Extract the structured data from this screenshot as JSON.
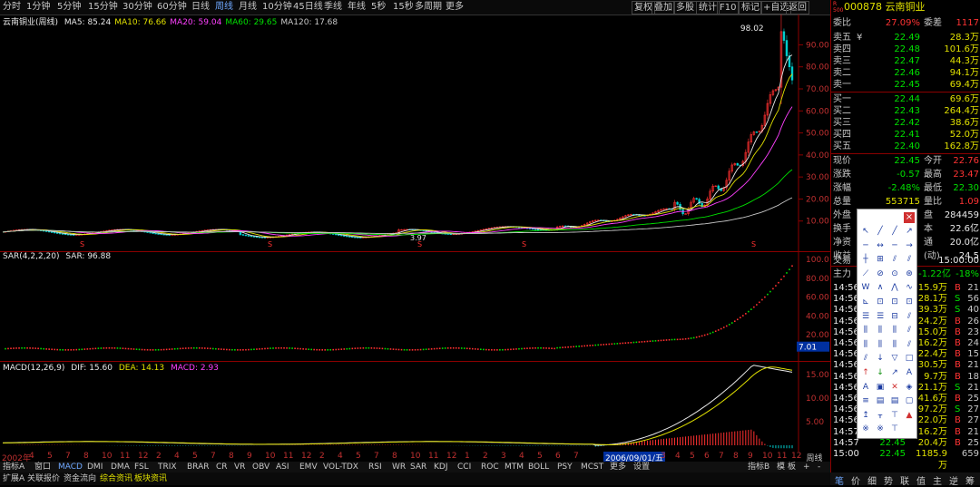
{
  "toolbar": {
    "periods": [
      "分时",
      "1分钟",
      "5分钟",
      "15分钟",
      "30分钟",
      "60分钟",
      "日线",
      "周线",
      "月线",
      "10分钟",
      "45日线",
      "季线",
      "年线",
      "5秒",
      "15秒",
      "多周期",
      "更多"
    ],
    "active_period": "周线",
    "right_buttons": [
      "复权",
      "叠加",
      "多股",
      "统计",
      "F10",
      "标记",
      "+自选",
      "返回"
    ]
  },
  "main_chart": {
    "stock_label": "云南铜业(周线)",
    "ma": [
      {
        "label": "MA5: 85.24",
        "color": "#e8e8e8"
      },
      {
        "label": "MA10: 76.66",
        "color": "#e0e000"
      },
      {
        "label": "MA20: 59.04",
        "color": "#ff40ff"
      },
      {
        "label": "MA60: 29.65",
        "color": "#00e000"
      },
      {
        "label": "MA120: 17.68",
        "color": "#c8c8c8"
      }
    ],
    "y_ticks": [
      "90.00",
      "80.00",
      "70.00",
      "60.00",
      "50.00",
      "40.00",
      "30.00",
      "20.00",
      "10.00"
    ],
    "high_label": "98.02",
    "low_label": "3.97"
  },
  "sar_chart": {
    "title": "SAR(4,2,2,20)",
    "value": "SAR: 96.88",
    "y_ticks": [
      "100.0",
      "80.00",
      "60.00",
      "40.00",
      "20.00"
    ],
    "current": "7.01"
  },
  "macd_chart": {
    "title": "MACD(12,26,9)",
    "dif": "DIF: 15.60",
    "dea": "DEA: 14.13",
    "macd": "MACD: 2.93",
    "y_ticks": [
      "15.00",
      "10.00",
      "5.00"
    ]
  },
  "xaxis": {
    "labels": [
      "2002年",
      "4",
      "5",
      "7",
      "8",
      "10",
      "11",
      "12",
      "2",
      "4",
      "5",
      "7",
      "8",
      "9",
      "10",
      "11",
      "12",
      "2",
      "4",
      "5",
      "7",
      "8",
      "10",
      "11",
      "12",
      "1",
      "2",
      "3",
      "4",
      "5",
      "6",
      "7"
    ],
    "highlight": "2006/09/01/五",
    "after": [
      "3",
      "4",
      "5",
      "6",
      "7",
      "8",
      "9",
      "10",
      "11",
      "12",
      "1",
      "2",
      "3",
      "4",
      "5",
      "6",
      "7",
      "8",
      "9",
      "10"
    ],
    "corner": "周线"
  },
  "bottom_tabs": {
    "items": [
      "指标A",
      "窗口",
      "MACD",
      "DMI",
      "DMA",
      "FSL",
      "TRIX",
      "BRAR",
      "CR",
      "VR",
      "OBV",
      "ASI",
      "EMV",
      "VOL-TDX",
      "RSI",
      "WR",
      "SAR",
      "KDJ",
      "CCI",
      "ROC",
      "MTM",
      "BOLL",
      "PSY",
      "MCST",
      "更多",
      "设置"
    ],
    "active": "MACD",
    "right": [
      "指标B",
      "模",
      "板",
      "+",
      "-"
    ]
  },
  "bottom_bar": {
    "items": [
      "扩展A",
      "关联报价",
      "资金流向",
      "综合资讯",
      "板块资讯"
    ]
  },
  "quote": {
    "code": "000878",
    "name": "云南铜业",
    "weibi_label": "委比",
    "weibi": "27.09%",
    "weicha_label": "委差",
    "weicha": "1117",
    "sells": [
      {
        "label": "卖五",
        "mark": "¥",
        "price": "22.49",
        "vol": "28.3万"
      },
      {
        "label": "卖四",
        "mark": "",
        "price": "22.48",
        "vol": "101.6万"
      },
      {
        "label": "卖三",
        "mark": "",
        "price": "22.47",
        "vol": "44.3万"
      },
      {
        "label": "卖二",
        "mark": "",
        "price": "22.46",
        "vol": "94.1万"
      },
      {
        "label": "卖一",
        "mark": "",
        "price": "22.45",
        "vol": "69.4万"
      }
    ],
    "buys": [
      {
        "label": "买一",
        "price": "22.44",
        "vol": "69.6万"
      },
      {
        "label": "买二",
        "price": "22.43",
        "vol": "264.4万"
      },
      {
        "label": "买三",
        "price": "22.42",
        "vol": "38.6万"
      },
      {
        "label": "买四",
        "price": "22.41",
        "vol": "52.0万"
      },
      {
        "label": "买五",
        "price": "22.40",
        "vol": "162.8万"
      }
    ],
    "stats": [
      {
        "l1": "现价",
        "v1": "22.45",
        "l2": "今开",
        "v2": "22.76"
      },
      {
        "l1": "涨跌",
        "v1": "-0.57",
        "l2": "最高",
        "v2": "23.47"
      },
      {
        "l1": "涨幅",
        "v1": "-2.48%",
        "l2": "最低",
        "v2": "22.30"
      },
      {
        "l1": "总量",
        "v1": "553715",
        "l2": "量比",
        "v2": "1.09"
      },
      {
        "l1": "外盘",
        "v1": "",
        "l2": "盘",
        "v2": "284459"
      },
      {
        "l1": "换手",
        "v1": "",
        "l2": "本",
        "v2": "22.6亿"
      },
      {
        "l1": "净资",
        "v1": "",
        "l2": "通",
        "v2": "20.0亿"
      },
      {
        "l1": "收益",
        "v1": "",
        "l2": "(动)",
        "v2": "24.5"
      }
    ],
    "trade_time_label": "交易",
    "trade_time": "15:00:00",
    "main_force_label": "主力",
    "main_force": "-1.22亿",
    "main_force_pct": "-18%",
    "ticks": [
      {
        "t": "14:56",
        "p": "",
        "v": "15.9万",
        "bs": "B",
        "n": "21"
      },
      {
        "t": "14:56",
        "p": "",
        "v": "28.1万",
        "bs": "S",
        "n": "56"
      },
      {
        "t": "14:56",
        "p": "",
        "v": "39.3万",
        "bs": "S",
        "n": "40"
      },
      {
        "t": "14:56",
        "p": "",
        "v": "24.2万",
        "bs": "B",
        "n": "26"
      },
      {
        "t": "14:56",
        "p": "",
        "v": "15.0万",
        "bs": "B",
        "n": "23"
      },
      {
        "t": "14:56",
        "p": "",
        "v": "16.2万",
        "bs": "B",
        "n": "24"
      },
      {
        "t": "14:56",
        "p": "",
        "v": "22.4万",
        "bs": "B",
        "n": "15"
      },
      {
        "t": "14:56",
        "p": "",
        "v": "30.5万",
        "bs": "B",
        "n": "21"
      },
      {
        "t": "14:56",
        "p": "",
        "v": "9.7万",
        "bs": "B",
        "n": "18"
      },
      {
        "t": "14:56",
        "p": "",
        "v": "21.1万",
        "bs": "S",
        "n": "21"
      },
      {
        "t": "14:56",
        "p": "",
        "v": "41.6万",
        "bs": "B",
        "n": "25"
      },
      {
        "t": "14:56",
        "p": "",
        "v": "97.2万",
        "bs": "S",
        "n": "27"
      },
      {
        "t": "14:56",
        "p": "",
        "v": "22.0万",
        "bs": "B",
        "n": "27"
      },
      {
        "t": "14:57",
        "p": "22.45",
        "v": "16.2万",
        "bs": "B",
        "n": "21"
      },
      {
        "t": "14:57",
        "p": "22.45",
        "v": "20.4万",
        "bs": "B",
        "n": "25"
      },
      {
        "t": "15:00",
        "p": "22.45",
        "v": "1185.9万",
        "bs": "",
        "n": "659"
      }
    ],
    "tabs": [
      "笔",
      "价",
      "细",
      "势",
      "联",
      "值",
      "主",
      "逆",
      "筹"
    ]
  },
  "drawtools_close": "×"
}
